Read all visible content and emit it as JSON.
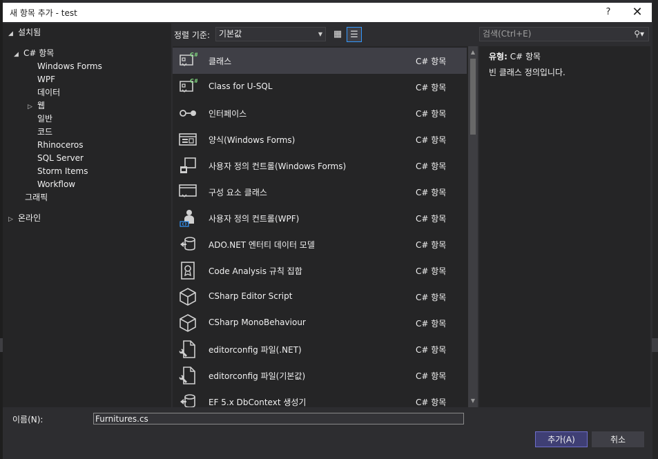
{
  "window": {
    "title": "새 항목 추가 - test",
    "help": "?",
    "close": "✕"
  },
  "tree": {
    "installed": {
      "label": "설치됨",
      "arrow": "◢"
    },
    "csharp": {
      "label": "C# 항목",
      "arrow": "◢"
    },
    "children": [
      "Windows Forms",
      "WPF",
      "데이터"
    ],
    "web": {
      "label": "웹",
      "arrow": "▷"
    },
    "children2": [
      "일반",
      "코드",
      "Rhinoceros",
      "SQL Server",
      "Storm Items",
      "Workflow"
    ],
    "graphics": "그래픽",
    "online": {
      "label": "온라인",
      "arrow": "▷"
    }
  },
  "toolbar": {
    "sort_label": "정렬 기준:",
    "sort_value": "기본값",
    "caret": "▼",
    "grid_view_icon": "▦",
    "list_view_icon": "☰"
  },
  "search": {
    "placeholder": "검색(Ctrl+E)",
    "icon": "⚲▾"
  },
  "items": [
    {
      "name": "클래스",
      "category": "C# 항목",
      "icon": "class-icon"
    },
    {
      "name": "Class for U-SQL",
      "category": "C# 항목",
      "icon": "class-icon"
    },
    {
      "name": "인터페이스",
      "category": "C# 항목",
      "icon": "interface-icon"
    },
    {
      "name": "양식(Windows Forms)",
      "category": "C# 항목",
      "icon": "form-icon"
    },
    {
      "name": "사용자 정의 컨트롤(Windows Forms)",
      "category": "C# 항목",
      "icon": "user-control-icon"
    },
    {
      "name": "구성 요소 클래스",
      "category": "C# 항목",
      "icon": "component-icon"
    },
    {
      "name": "사용자 정의 컨트롤(WPF)",
      "category": "C# 항목",
      "icon": "wpf-control-icon"
    },
    {
      "name": "ADO.NET 엔터티 데이터 모델",
      "category": "C# 항목",
      "icon": "entity-model-icon"
    },
    {
      "name": "Code Analysis 규칙 집합",
      "category": "C# 항목",
      "icon": "ruleset-icon"
    },
    {
      "name": "CSharp Editor Script",
      "category": "C# 항목",
      "icon": "cube-icon"
    },
    {
      "name": "CSharp MonoBehaviour",
      "category": "C# 항목",
      "icon": "cube-icon"
    },
    {
      "name": "editorconfig 파일(.NET)",
      "category": "C# 항목",
      "icon": "editorconfig-icon"
    },
    {
      "name": "editorconfig 파일(기본값)",
      "category": "C# 항목",
      "icon": "editorconfig-icon"
    },
    {
      "name": "EF 5.x DbContext 생성기",
      "category": "C# 항목",
      "icon": "entity-model-icon"
    }
  ],
  "scrollbar": {
    "up": "▲",
    "down": "▼"
  },
  "detail": {
    "type_label": "유형:",
    "type_value": "C# 항목",
    "description": "빈 클래스 정의입니다."
  },
  "form": {
    "name_label": "이름(N):",
    "name_value": "Furnitures.cs",
    "add_button": "추가(A)",
    "cancel_button": "취소"
  }
}
